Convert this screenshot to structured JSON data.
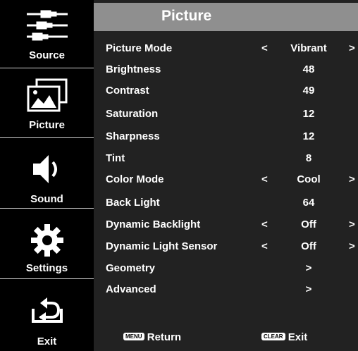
{
  "sidebar": {
    "items": [
      {
        "label": "Source",
        "icon": "source-cables-icon"
      },
      {
        "label": "Picture",
        "icon": "picture-icon"
      },
      {
        "label": "Sound",
        "icon": "speaker-icon"
      },
      {
        "label": "Settings",
        "icon": "gear-icon"
      },
      {
        "label": "Exit",
        "icon": "exit-icon"
      }
    ]
  },
  "header": {
    "title": "Picture"
  },
  "menu": {
    "rows": [
      {
        "name": "Picture Mode",
        "value": "Vibrant",
        "left_arrow": "<",
        "right_arrow": ">"
      },
      {
        "name": "Brightness",
        "value": "48"
      },
      {
        "name": "Contrast",
        "value": "49"
      },
      {
        "name": "Saturation",
        "value": "12"
      },
      {
        "name": "Sharpness",
        "value": "12"
      },
      {
        "name": "Tint",
        "value": "8"
      },
      {
        "name": "Color Mode",
        "value": "Cool",
        "left_arrow": "<",
        "right_arrow": ">"
      },
      {
        "name": "Back Light",
        "value": "64"
      },
      {
        "name": "Dynamic Backlight",
        "value": "Off",
        "left_arrow": "<",
        "right_arrow": ">"
      },
      {
        "name": "Dynamic Light Sensor",
        "value": "Off",
        "left_arrow": "<",
        "right_arrow": ">"
      },
      {
        "name": "Geometry",
        "value": ">"
      },
      {
        "name": "Advanced",
        "value": ">"
      }
    ]
  },
  "footer": {
    "menu_key": "MENU",
    "menu_action": "Return",
    "clear_key": "CLEAR",
    "clear_action": "Exit"
  },
  "colors": {
    "panel": "#222222",
    "title_bar": "#8f8f8f",
    "sidebar": "#000000",
    "text": "#ffffff"
  }
}
